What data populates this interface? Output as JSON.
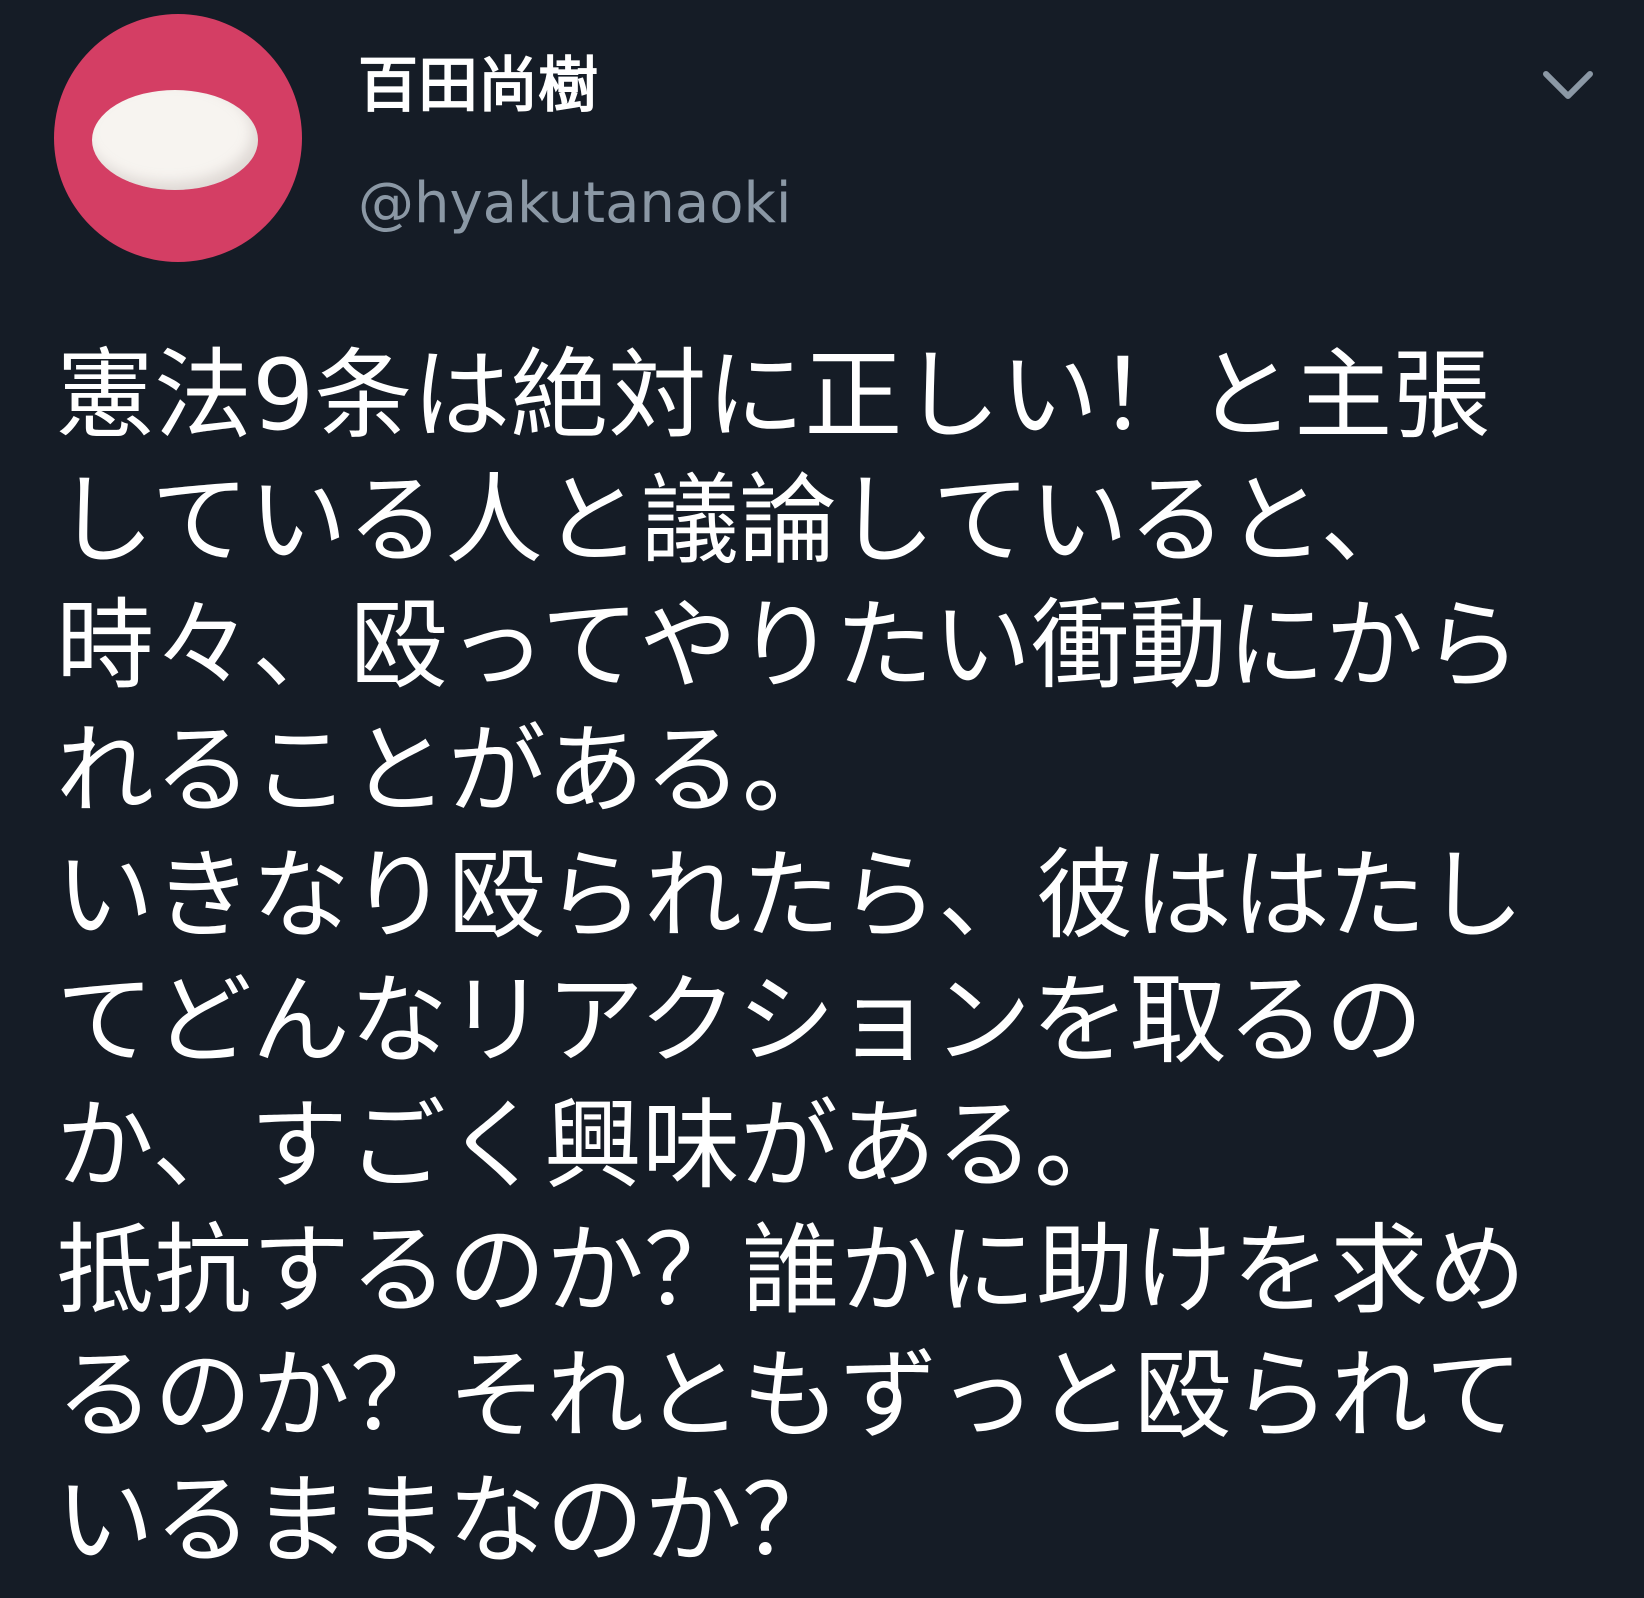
{
  "author": {
    "display_name": "百田尚樹",
    "handle": "@hyakutanaoki",
    "avatar_icon": "egg-avatar-icon",
    "avatar_color": "#d43e64"
  },
  "menu": {
    "icon": "chevron-down-icon"
  },
  "tweet": {
    "lines": [
      "憲法9条は絶対に正しい！と主張",
      "している人と議論していると、",
      "時々、殴ってやりたい衝動にから",
      "れることがある。",
      "いきなり殴られたら、彼ははたし",
      "てどんなリアクションを取るの",
      "か、すごく興味がある。",
      "抵抗するのか？誰かに助けを求め",
      "るのか？それともずっと殴られて",
      "いるままなのか？"
    ]
  },
  "colors": {
    "background": "#151c26",
    "text": "#ffffff",
    "secondary_text": "#8b98a5"
  }
}
